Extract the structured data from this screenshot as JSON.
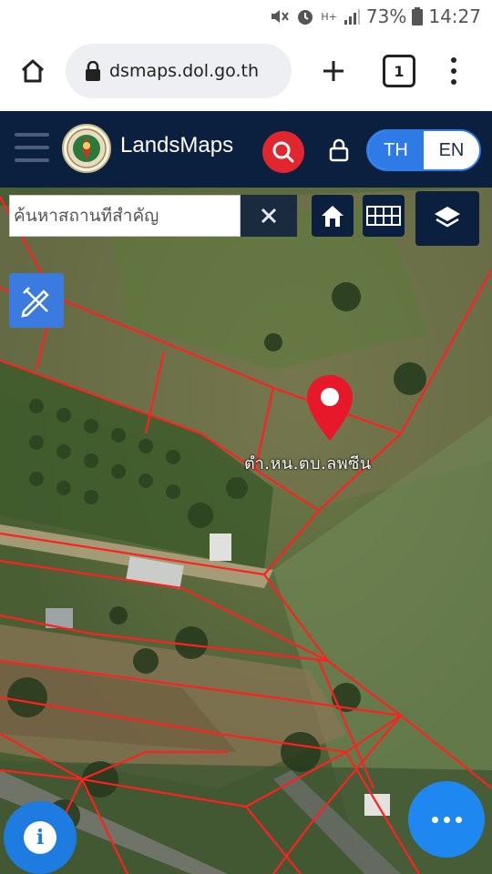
{
  "status_bar": {
    "time": "14:27",
    "battery": "73%",
    "network": "H+",
    "icons": [
      "mute-icon",
      "alarm-icon",
      "signal-icon",
      "battery-icon"
    ]
  },
  "browser": {
    "url": "dsmaps.dol.go.th",
    "tab_count": "1",
    "icons": [
      "home-icon",
      "lock-icon",
      "plus-icon",
      "tabs-icon",
      "overflow-menu-icon"
    ]
  },
  "app": {
    "brand": "LandsMaps",
    "lang_th": "TH",
    "lang_en": "EN",
    "active_lang": "TH",
    "colors": {
      "header": "#0b1f3f",
      "search": "#e0262e",
      "accent": "#2e7ae6"
    }
  },
  "map": {
    "search_placeholder": "ค้นหาสถานที่สำคัญ",
    "parcel_label": "ตำ.หน.ตบ.ลพซีน",
    "parcel_line_color": "#ff2020",
    "marker_color": "#e8182b"
  }
}
